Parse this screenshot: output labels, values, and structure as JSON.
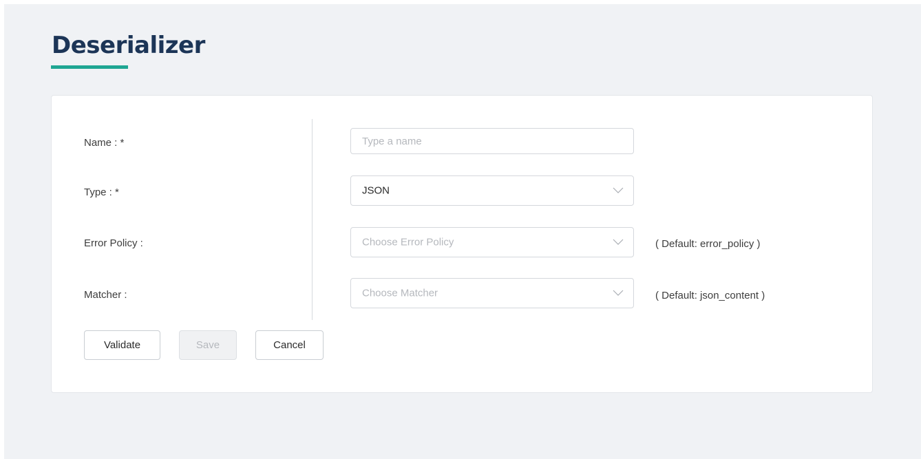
{
  "page": {
    "title": "Deserializer",
    "accent_color": "#1fa693",
    "title_color": "#1c3557"
  },
  "form": {
    "name": {
      "label": "Name : *",
      "value": "",
      "placeholder": "Type a name"
    },
    "type": {
      "label": "Type : *",
      "selected": "JSON",
      "icon": "chevron-down-icon"
    },
    "error_policy": {
      "label": "Error Policy :",
      "placeholder": "Choose Error Policy",
      "hint": "( Default: error_policy )",
      "icon": "chevron-down-icon"
    },
    "matcher": {
      "label": "Matcher :",
      "placeholder": "Choose Matcher",
      "hint": "( Default: json_content )",
      "icon": "chevron-down-icon"
    }
  },
  "buttons": {
    "validate": "Validate",
    "save": "Save",
    "save_disabled": true,
    "cancel": "Cancel"
  }
}
